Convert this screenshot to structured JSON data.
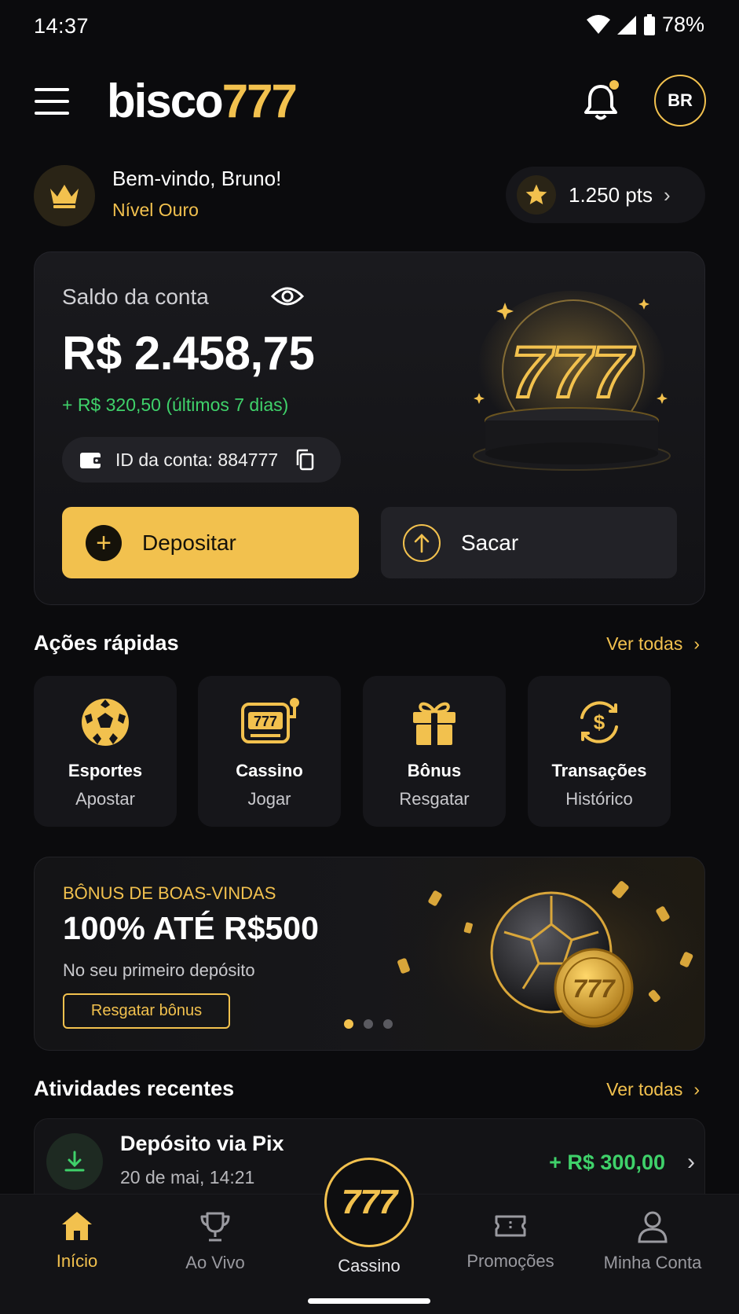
{
  "status_bar": {
    "time": "14:37",
    "battery": "78%"
  },
  "header": {
    "logo_white": "bisco",
    "logo_gold": "777",
    "avatar_initials": "BR"
  },
  "welcome": {
    "greeting": "Bem-vindo, Bruno!",
    "level": "Nível Ouro",
    "points": "1.250 pts"
  },
  "balance": {
    "label": "Saldo da conta",
    "amount": "R$ 2.458,75",
    "gain": "+ R$ 320,50 (últimos 7 dias)",
    "account_id": "ID da conta: 884777",
    "deposit_label": "Depositar",
    "withdraw_label": "Sacar"
  },
  "quick_actions": {
    "title": "Ações rápidas",
    "see_all": "Ver todas",
    "items": [
      {
        "title": "Esportes",
        "subtitle": "Apostar",
        "icon": "soccer-ball-icon"
      },
      {
        "title": "Cassino",
        "subtitle": "Jogar",
        "icon": "slot-machine-icon"
      },
      {
        "title": "Bônus",
        "subtitle": "Resgatar",
        "icon": "gift-icon"
      },
      {
        "title": "Transações",
        "subtitle": "Histórico",
        "icon": "dollar-cycle-icon"
      }
    ]
  },
  "promo": {
    "kicker": "BÔNUS DE BOAS-VINDAS",
    "title": "100% ATÉ R$500",
    "subtitle": "No seu primeiro depósito",
    "button": "Resgatar bônus",
    "coin_text": "777",
    "active_dot": 0
  },
  "recent": {
    "title": "Atividades recentes",
    "see_all": "Ver todas",
    "items": [
      {
        "title": "Depósito via Pix",
        "date": "20 de mai, 14:21",
        "amount": "+ R$ 300,00"
      }
    ]
  },
  "bottom_nav": {
    "items": [
      {
        "label": "Início",
        "active": true
      },
      {
        "label": "Ao Vivo",
        "active": false
      },
      {
        "label": "Cassino",
        "active": false
      },
      {
        "label": "Promoções",
        "active": false
      },
      {
        "label": "Minha Conta",
        "active": false
      }
    ],
    "center_text": "777"
  },
  "slot_text": "777",
  "colors": {
    "accent": "#f2c14e",
    "background": "#0b0b0d",
    "positive": "#3fd16a"
  }
}
